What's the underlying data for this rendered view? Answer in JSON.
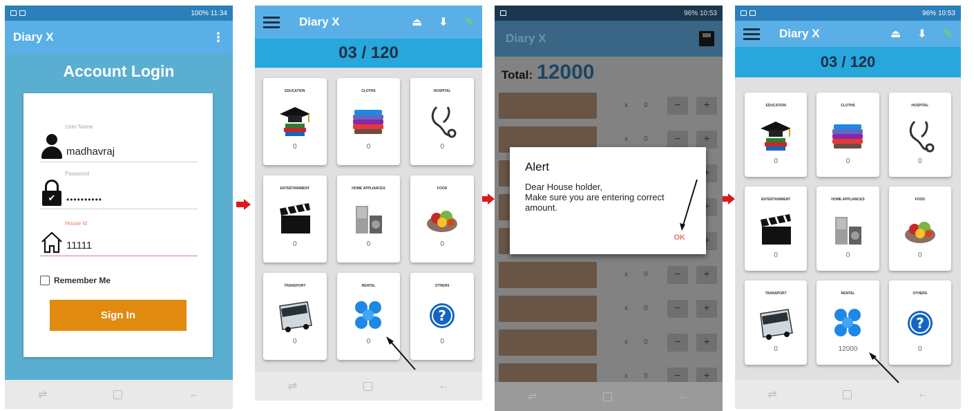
{
  "flow_arrows": [
    "right-arrow",
    "right-arrow",
    "right-arrow"
  ],
  "screen1": {
    "status_time": "11:34",
    "status_battery": "100%",
    "app_title": "Diary X",
    "login_title": "Account Login",
    "username": {
      "label": "User Name",
      "value": "madhavraj"
    },
    "password": {
      "label": "Password",
      "value": "••••••••••"
    },
    "house_id": {
      "label": "House Id",
      "value": "11111"
    },
    "remember_label": "Remember Me",
    "signin_label": "Sign In"
  },
  "dashboard": {
    "app_title": "Diary X",
    "counter": "03 / 120",
    "tiles": [
      {
        "label": "EDUCATION",
        "value": "0",
        "icon": "education-icon"
      },
      {
        "label": "CLOTHS",
        "value": "0",
        "icon": "clothes-icon"
      },
      {
        "label": "HOSPITAL",
        "value": "0",
        "icon": "hospital-icon"
      },
      {
        "label": "ENTERTAINMENT",
        "value": "0",
        "icon": "entertainment-icon"
      },
      {
        "label": "HOME APPLIANCES",
        "value": "0",
        "icon": "appliances-icon"
      },
      {
        "label": "FOOD",
        "value": "0",
        "icon": "food-icon"
      },
      {
        "label": "TRANSPORT",
        "value": "0",
        "icon": "transport-icon"
      },
      {
        "label": "RENTAL",
        "value": "0",
        "icon": "rental-icon"
      },
      {
        "label": "OTHERS",
        "value": "0",
        "icon": "others-icon"
      }
    ]
  },
  "screen3": {
    "status_time": "10:53",
    "status_battery": "96%",
    "app_title": "Diary X",
    "total_label": "Total:",
    "total_value": "12000",
    "note_rows": [
      {
        "x": "x",
        "qty": "0"
      },
      {
        "x": "x",
        "qty": "0"
      },
      {
        "x": "x",
        "qty": "0"
      },
      {
        "x": "x",
        "qty": "0"
      },
      {
        "x": "x",
        "qty": "0"
      },
      {
        "x": "x",
        "qty": "0"
      },
      {
        "x": "x",
        "qty": "0"
      },
      {
        "x": "x",
        "qty": "0"
      },
      {
        "x": "x",
        "qty": "0"
      }
    ],
    "alert": {
      "title": "Alert",
      "message_line1": "Dear House holder,",
      "message_line2": "Make sure you are entering correct amount.",
      "ok_label": "OK"
    }
  },
  "screen4": {
    "status_time": "10:53",
    "status_battery": "96%",
    "app_title": "Diary X",
    "counter": "03 / 120",
    "tiles": [
      {
        "label": "EDUCATION",
        "value": "0",
        "icon": "education-icon"
      },
      {
        "label": "CLOTHS",
        "value": "0",
        "icon": "clothes-icon"
      },
      {
        "label": "HOSPITAL",
        "value": "0",
        "icon": "hospital-icon"
      },
      {
        "label": "ENTERTAINMENT",
        "value": "0",
        "icon": "entertainment-icon"
      },
      {
        "label": "HOME APPLIANCES",
        "value": "0",
        "icon": "appliances-icon"
      },
      {
        "label": "FOOD",
        "value": "0",
        "icon": "food-icon"
      },
      {
        "label": "TRANSPORT",
        "value": "0",
        "icon": "transport-icon"
      },
      {
        "label": "RENTAL",
        "value": "12000",
        "icon": "rental-icon"
      },
      {
        "label": "OTHERS",
        "value": "0",
        "icon": "others-icon"
      }
    ]
  },
  "colors": {
    "app_bar": "#5ab0e6",
    "counter_bar": "#27a7dc",
    "login_bg": "#5aaed0",
    "sign_in": "#e08a10",
    "accent_red": "#e07a6a",
    "flow_arrow": "#d81c1c"
  }
}
